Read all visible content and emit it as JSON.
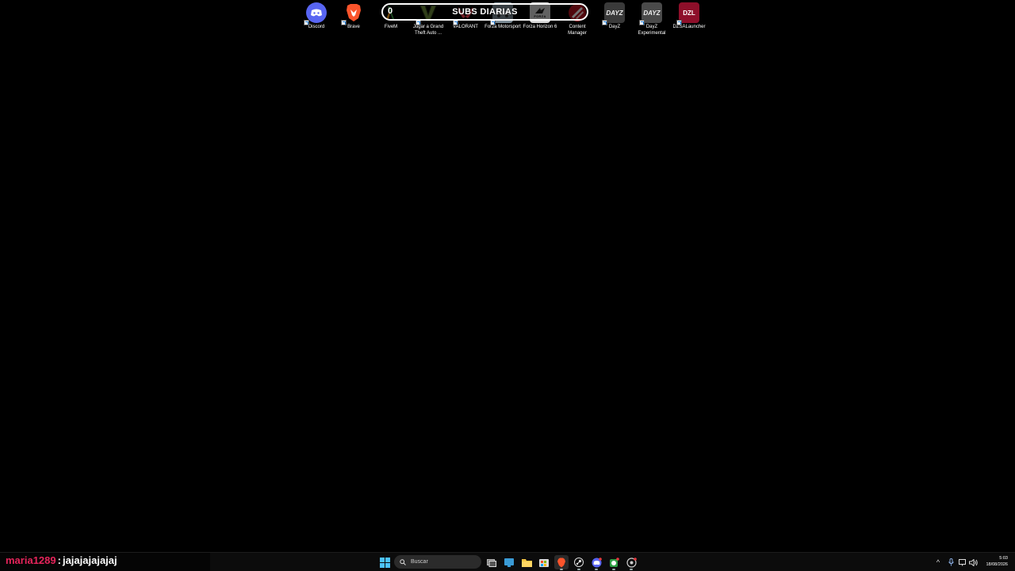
{
  "desktop": {
    "icons": [
      {
        "label": "Discord",
        "icon": "discord-icon"
      },
      {
        "label": "Brave",
        "icon": "brave-lion-icon"
      },
      {
        "label": "FiveM",
        "icon": "fivem-icon"
      },
      {
        "label": "Jugar a Grand Theft Auto ...",
        "icon": "gta-v-icon"
      },
      {
        "label": "VALORANT",
        "icon": "valorant-icon"
      },
      {
        "label": "Forza Motorsport",
        "icon": "forza-motorsport-icon"
      },
      {
        "label": "Forza Horizon 6",
        "icon": "forza-horizon-icon",
        "badge": "FORZA"
      },
      {
        "label": "Content Manager",
        "icon": "content-manager-icon"
      },
      {
        "label": "DayZ",
        "icon": "dayz-icon",
        "badge": "DAYZ"
      },
      {
        "label": "DayZ Experimental",
        "icon": "dayz-experimental-icon",
        "badge": "DAYZ"
      },
      {
        "label": "DZSALauncher",
        "icon": "dzsa-launcher-icon",
        "badge": "DZL"
      }
    ]
  },
  "overlay": {
    "banner_text": "SUBS DIARIAS",
    "banner_glyph": "0"
  },
  "chat": {
    "username": "maria1289",
    "separator": ":",
    "message": "jajajajajajaj"
  },
  "taskbar": {
    "search_placeholder": "Buscar",
    "pinned": [
      "start-icon",
      "task-view-icon",
      "widgets-icon",
      "file-explorer-icon",
      "store-icon",
      "brave-icon",
      "steam-icon",
      "discord-icon",
      "xbox-icon",
      "chrome-icon"
    ],
    "active_app": "brave-icon"
  },
  "clock": {
    "time": "5:03",
    "date": "18/08/2026"
  },
  "colors": {
    "desktop_bg": "#000000",
    "taskbar_bg": "#0c0c0c",
    "chat_username": "#e6245b",
    "discord": "#5865f2",
    "brave": "#fb542b"
  }
}
